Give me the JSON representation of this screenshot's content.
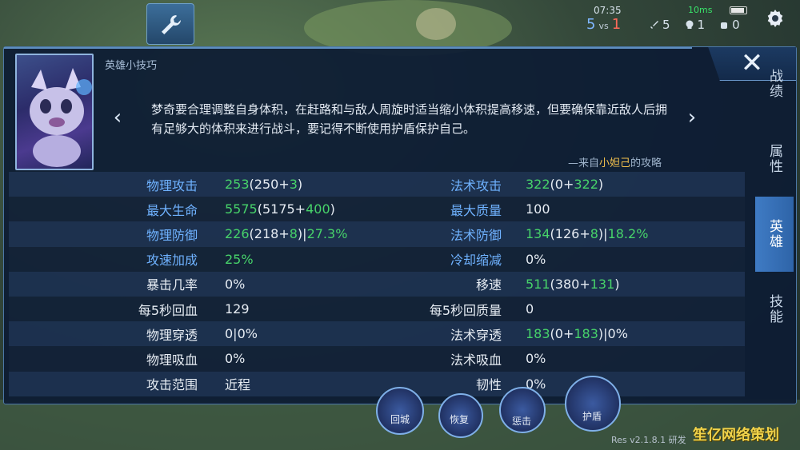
{
  "hud": {
    "time": "07:35",
    "score_blue": "5",
    "vs_label": "vs",
    "score_red": "1",
    "kills": "5",
    "deaths": "1",
    "assists": "0",
    "network": "10ms"
  },
  "panel": {
    "tips_title": "英雄小技巧",
    "tip_text": "梦奇要合理调整自身体积，在赶路和与敌人周旋时适当缩小体积提高移速，但要确保靠近敌人后拥有足够大的体积来进行战斗，要记得不断使用护盾保护自己。",
    "tip_source_prefix": "—来自",
    "tip_source_author": "小妲己",
    "tip_source_suffix": "的攻略",
    "close_label": "✕",
    "prev_label": "‹",
    "next_label": "›"
  },
  "side_tabs": [
    {
      "label": "战绩",
      "active": false
    },
    {
      "label": "属性",
      "active": false
    },
    {
      "label": "英雄",
      "active": true
    },
    {
      "label": "技能",
      "active": false
    }
  ],
  "stats": [
    {
      "l_label": "物理攻击",
      "l_blue": true,
      "l_main": "253",
      "l_rest": "(250+",
      "l_bonus": "3",
      "l_tail": ")",
      "l_pct": "",
      "r_label": "法术攻击",
      "r_blue": true,
      "r_main": "322",
      "r_rest": "(0+",
      "r_bonus": "322",
      "r_tail": ")",
      "r_pct": ""
    },
    {
      "l_label": "最大生命",
      "l_blue": true,
      "l_main": "5575",
      "l_rest": "(5175+",
      "l_bonus": "400",
      "l_tail": ")",
      "l_pct": "",
      "r_label": "最大质量",
      "r_blue": true,
      "r_main": "100",
      "r_rest": "",
      "r_bonus": "",
      "r_tail": "",
      "r_pct": "",
      "r_plain": true
    },
    {
      "l_label": "物理防御",
      "l_blue": true,
      "l_main": "226",
      "l_rest": "(218+",
      "l_bonus": "8",
      "l_tail": ")|",
      "l_pct": "27.3%",
      "r_label": "法术防御",
      "r_blue": true,
      "r_main": "134",
      "r_rest": "(126+",
      "r_bonus": "8",
      "r_tail": ")|",
      "r_pct": "18.2%"
    },
    {
      "l_label": "攻速加成",
      "l_blue": true,
      "l_main": "25%",
      "l_rest": "",
      "l_bonus": "",
      "l_tail": "",
      "l_pct": "",
      "r_label": "冷却缩减",
      "r_blue": true,
      "r_main": "0%",
      "r_rest": "",
      "r_bonus": "",
      "r_tail": "",
      "r_pct": "",
      "r_plain": true
    },
    {
      "l_label": "暴击几率",
      "l_blue": false,
      "l_main": "0%",
      "l_rest": "",
      "l_bonus": "",
      "l_tail": "",
      "l_pct": "",
      "l_plain": true,
      "r_label": "移速",
      "r_blue": false,
      "r_main": "511",
      "r_rest": "(380+",
      "r_bonus": "131",
      "r_tail": ")",
      "r_pct": ""
    },
    {
      "l_label": "每5秒回血",
      "l_blue": false,
      "l_main": "129",
      "l_rest": "",
      "l_bonus": "",
      "l_tail": "",
      "l_pct": "",
      "l_plain": true,
      "r_label": "每5秒回质量",
      "r_blue": false,
      "r_main": "0",
      "r_rest": "",
      "r_bonus": "",
      "r_tail": "",
      "r_pct": "",
      "r_plain": true
    },
    {
      "l_label": "物理穿透",
      "l_blue": false,
      "l_main": "0|0%",
      "l_rest": "",
      "l_bonus": "",
      "l_tail": "",
      "l_pct": "",
      "l_plain": true,
      "r_label": "法术穿透",
      "r_blue": false,
      "r_main": "183",
      "r_rest": "(0+",
      "r_bonus": "183",
      "r_tail": ")|0%",
      "r_pct": ""
    },
    {
      "l_label": "物理吸血",
      "l_blue": false,
      "l_main": "0%",
      "l_rest": "",
      "l_bonus": "",
      "l_tail": "",
      "l_pct": "",
      "l_plain": true,
      "r_label": "法术吸血",
      "r_blue": false,
      "r_main": "0%",
      "r_rest": "",
      "r_bonus": "",
      "r_tail": "",
      "r_pct": "",
      "r_plain": true
    },
    {
      "l_label": "攻击范围",
      "l_blue": false,
      "l_main": "近程",
      "l_rest": "",
      "l_bonus": "",
      "l_tail": "",
      "l_pct": "",
      "l_plain": true,
      "r_label": "韧性",
      "r_blue": false,
      "r_main": "0%",
      "r_rest": "",
      "r_bonus": "",
      "r_tail": "",
      "r_pct": "",
      "r_plain": true
    }
  ],
  "skills": {
    "recall": "回城",
    "heal": "恢复",
    "punish": "惩击",
    "shield": "护盾"
  },
  "version": "Res v2.1.8.1 研发",
  "watermark": "笙亿网络策划",
  "colors": {
    "accent_blue": "#6fb2ff",
    "bonus_green": "#47d36a",
    "author_gold": "#f2c04d",
    "active_tab": "#3f7bc4"
  },
  "icons": {
    "tool": "wrench-icon",
    "settings": "gear-icon",
    "close": "close-icon"
  }
}
